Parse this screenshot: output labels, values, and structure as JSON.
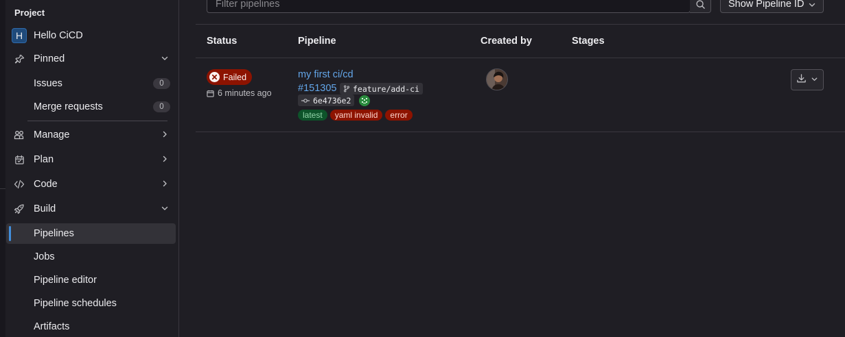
{
  "sidebar": {
    "section_title": "Project",
    "project": {
      "avatar_letter": "H",
      "name": "Hello CiCD"
    },
    "pinned": {
      "label": "Pinned",
      "icon": "pin-icon"
    },
    "pinned_items": [
      {
        "label": "Issues",
        "count": "0"
      },
      {
        "label": "Merge requests",
        "count": "0"
      }
    ],
    "groups": [
      {
        "label": "Manage",
        "icon": "users-icon"
      },
      {
        "label": "Plan",
        "icon": "calendar-icon"
      },
      {
        "label": "Code",
        "icon": "code-icon"
      },
      {
        "label": "Build",
        "icon": "rocket-icon"
      }
    ],
    "build_items": [
      {
        "label": "Pipelines",
        "active": true
      },
      {
        "label": "Jobs"
      },
      {
        "label": "Pipeline editor"
      },
      {
        "label": "Pipeline schedules"
      },
      {
        "label": "Artifacts"
      }
    ]
  },
  "toolbar": {
    "filter_placeholder": "Filter pipelines",
    "sort_label": "Show Pipeline ID"
  },
  "table": {
    "headers": {
      "status": "Status",
      "pipeline": "Pipeline",
      "created_by": "Created by",
      "stages": "Stages"
    },
    "rows": [
      {
        "status": "Failed",
        "time": "6 minutes ago",
        "title": "my first ci/cd",
        "id": "#151305",
        "ref": "feature/add-ci",
        "commit": "6e4736e2",
        "badges": [
          "latest",
          "yaml invalid",
          "error"
        ]
      }
    ]
  },
  "colors": {
    "accent": "#428fdc",
    "link": "#63a6e9",
    "failed": "#8d1300",
    "latest": "#0d532a"
  }
}
